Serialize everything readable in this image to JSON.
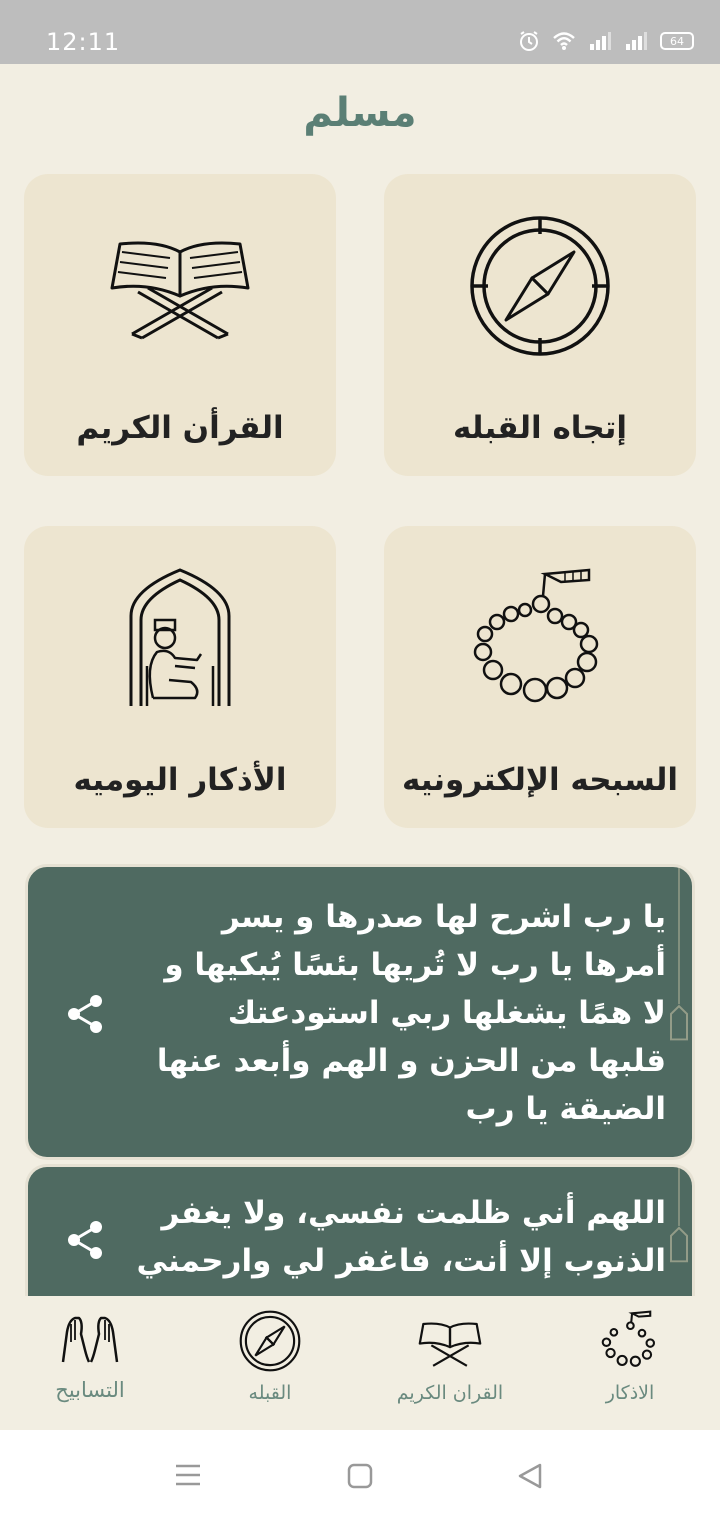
{
  "status": {
    "time": "12:11",
    "battery": "64"
  },
  "app": {
    "title": "مسلم"
  },
  "cards": {
    "qibla": {
      "label": "إتجاه القبله",
      "icon": "compass-icon"
    },
    "quran": {
      "label": "القرأن الكريم",
      "icon": "quran-stand-icon"
    },
    "tasbih": {
      "label": "السبحه الإلكترونيه",
      "icon": "prayer-beads-icon"
    },
    "azkar": {
      "label": "الأذكار اليوميه",
      "icon": "praying-person-icon"
    }
  },
  "duas": [
    {
      "text": "يا رب اشرح لها صدرها و يسر أمرها يا رب لا تُريها بئسًا يُبكيها و لا همًا يشغلها ربي استودعتك قلبها من الحزن و الهم وأبعد عنها الضيقة يا رب"
    },
    {
      "text": "اللهم أني ظلمت نفسي، ولا يغفر الذنوب إلا أنت، فاغفر لي وارحمني"
    }
  ],
  "bottom_nav": {
    "azkar": "الاذكار",
    "quran": "القران الكريم",
    "qibla": "القبله",
    "tasabih": "التسابيح"
  },
  "colors": {
    "accent": "#5b7f75",
    "card": "#ede5d0",
    "dua_bg": "#4f6a61",
    "background": "#f2eee2"
  }
}
